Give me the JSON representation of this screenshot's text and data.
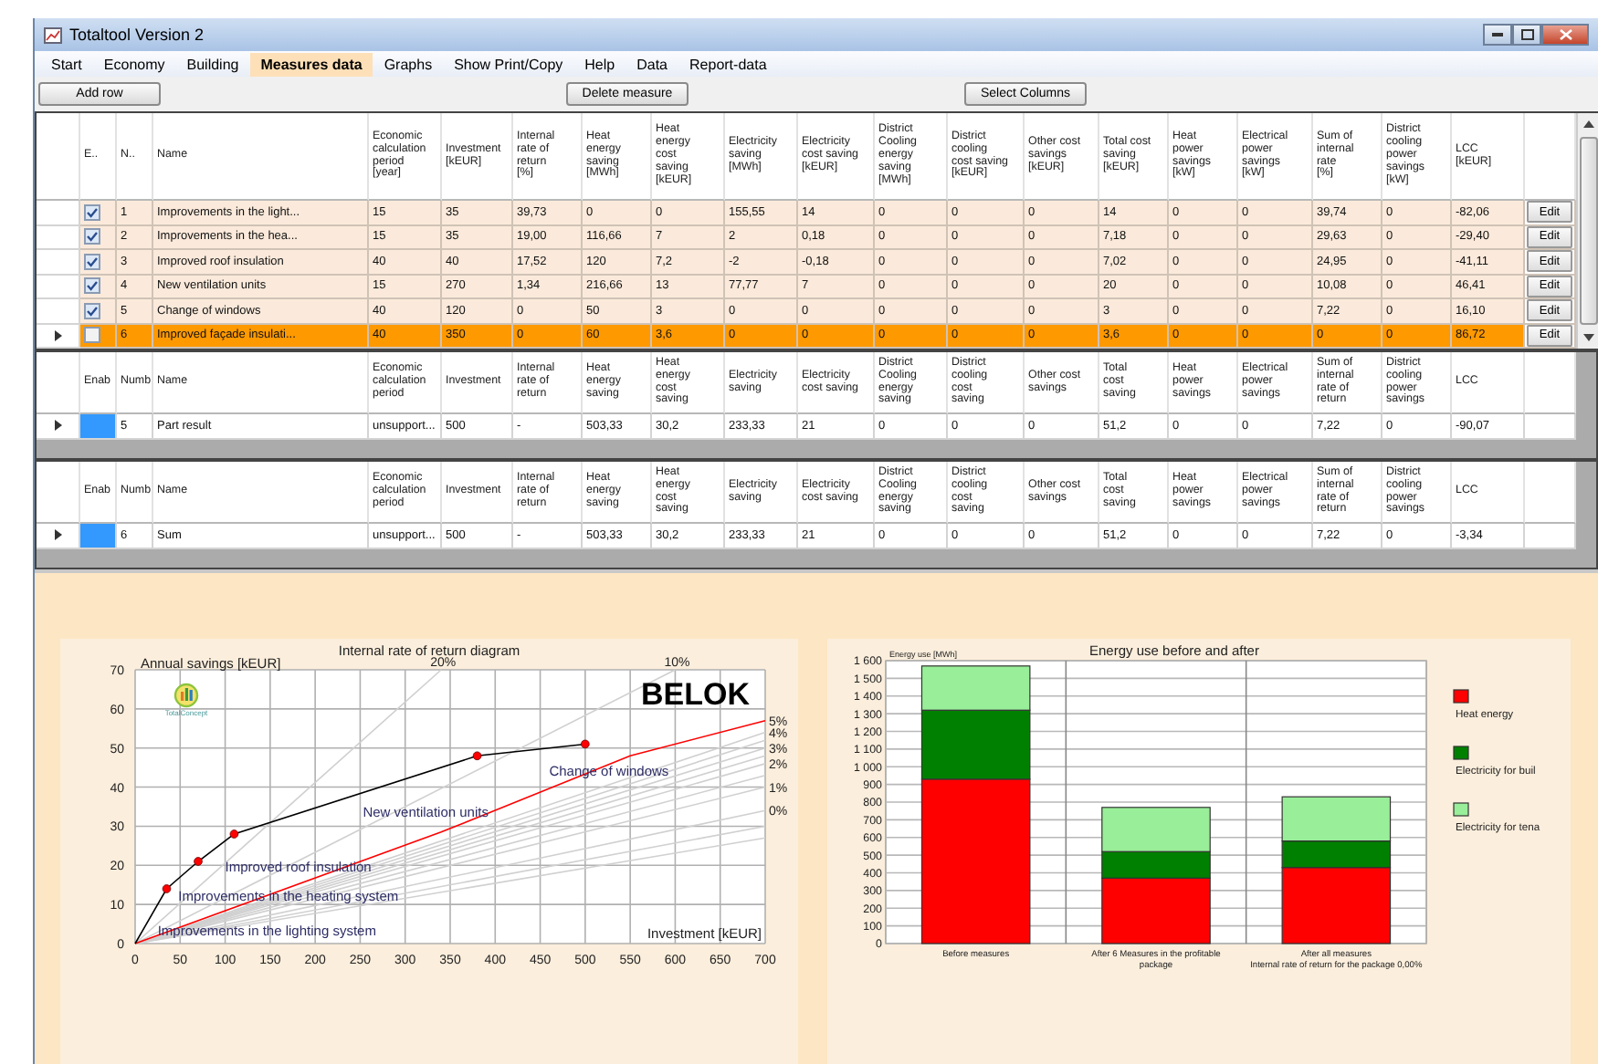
{
  "window": {
    "title": "Totaltool Version 2"
  },
  "menu": [
    {
      "label": "Start",
      "selected": false
    },
    {
      "label": "Economy",
      "selected": false
    },
    {
      "label": "Building",
      "selected": false
    },
    {
      "label": "Measures data",
      "selected": true
    },
    {
      "label": "Graphs",
      "selected": false
    },
    {
      "label": "Show Print/Copy",
      "selected": false
    },
    {
      "label": "Help",
      "selected": false
    },
    {
      "label": "Data",
      "selected": false
    },
    {
      "label": "Report-data",
      "selected": false
    }
  ],
  "toolbar": [
    "Add row",
    "Delete measure",
    "Select Columns"
  ],
  "measures": {
    "columns": [
      "E..",
      "N..",
      "Name",
      "Economic\ncalculation\nperiod\n[year]",
      "Investment\n[kEUR]",
      "Internal\nrate of\nreturn\n[%]",
      "Heat\nenergy\nsaving\n[MWh]",
      "Heat\nenergy\ncost\nsaving\n[kEUR]",
      "Electricity\nsaving\n[MWh]",
      "Electricity\ncost saving\n[kEUR]",
      "District\nCooling\nenergy\nsaving\n[MWh]",
      "District\ncooling\ncost saving\n[kEUR]",
      "Other cost\nsavings\n[kEUR]",
      "Total cost\nsaving\n[kEUR]",
      "Heat\npower\nsavings\n[kW]",
      "Electrical\npower\nsavings\n[kW]",
      "Sum of\ninternal\nrate\n[%]",
      "District\ncooling\npower\nsavings\n[kW]",
      "LCC\n[kEUR]"
    ],
    "rows": [
      {
        "enabled": true,
        "selected": false,
        "cells": [
          "",
          "1",
          "Improvements in the light...",
          "15",
          "35",
          "39,73",
          "0",
          "0",
          "155,55",
          "14",
          "0",
          "0",
          "0",
          "14",
          "0",
          "0",
          "39,74",
          "0",
          "-82,06"
        ],
        "button": "Edit"
      },
      {
        "enabled": true,
        "selected": false,
        "cells": [
          "",
          "2",
          "Improvements in the hea...",
          "15",
          "35",
          "19,00",
          "116,66",
          "7",
          "2",
          "0,18",
          "0",
          "0",
          "0",
          "7,18",
          "0",
          "0",
          "29,63",
          "0",
          "-29,40"
        ],
        "button": "Edit"
      },
      {
        "enabled": true,
        "selected": false,
        "cells": [
          "",
          "3",
          "Improved roof insulation",
          "40",
          "40",
          "17,52",
          "120",
          "7,2",
          "-2",
          "-0,18",
          "0",
          "0",
          "0",
          "7,02",
          "0",
          "0",
          "24,95",
          "0",
          "-41,11"
        ],
        "button": "Edit"
      },
      {
        "enabled": true,
        "selected": false,
        "cells": [
          "",
          "4",
          "New ventilation units",
          "15",
          "270",
          "1,34",
          "216,66",
          "13",
          "77,77",
          "7",
          "0",
          "0",
          "0",
          "20",
          "0",
          "0",
          "10,08",
          "0",
          "46,41"
        ],
        "button": "Edit"
      },
      {
        "enabled": true,
        "selected": false,
        "cells": [
          "",
          "5",
          "Change of windows",
          "40",
          "120",
          "0",
          "50",
          "3",
          "0",
          "0",
          "0",
          "0",
          "0",
          "3",
          "0",
          "0",
          "7,22",
          "0",
          "16,10"
        ],
        "button": "Edit"
      },
      {
        "enabled": false,
        "selected": true,
        "cells": [
          "",
          "6",
          "Improved façade insulati...",
          "40",
          "350",
          "0",
          "60",
          "3,6",
          "0",
          "0",
          "0",
          "0",
          "0",
          "3,6",
          "0",
          "0",
          "0",
          "0",
          "86,72"
        ],
        "button": "Edit"
      }
    ]
  },
  "part_result": {
    "columns": [
      "Enab",
      "Numb",
      "Name",
      "Economic\ncalculation\nperiod",
      "Investment",
      "Internal\nrate of\nreturn",
      "Heat\nenergy\nsaving",
      "Heat\nenergy\ncost\nsaving",
      "Electricity\nsaving",
      "Electricity\ncost saving",
      "District\nCooling\nenergy\nsaving",
      "District\ncooling\ncost\nsaving",
      "Other cost\nsavings",
      "Total\ncost\nsaving",
      "Heat\npower\nsavings",
      "Electrical\npower\nsavings",
      "Sum of\ninternal\nrate of\nreturn",
      "District\ncooling\npower\nsavings",
      "LCC"
    ],
    "rows": [
      {
        "selected": true,
        "cells": [
          "",
          "5",
          "Part result",
          "unsupport...",
          "500",
          "-",
          "503,33",
          "30,2",
          "233,33",
          "21",
          "0",
          "0",
          "0",
          "51,2",
          "0",
          "0",
          "7,22",
          "0",
          "-90,07"
        ]
      }
    ]
  },
  "sum": {
    "columns": [
      "Enab",
      "Numb",
      "Name",
      "Economic\ncalculation\nperiod",
      "Investment",
      "Internal\nrate of\nreturn",
      "Heat\nenergy\nsaving",
      "Heat\nenergy\ncost\nsaving",
      "Electricity\nsaving",
      "Electricity\ncost saving",
      "District\nCooling\nenergy\nsaving",
      "District\ncooling\ncost\nsaving",
      "Other cost\nsavings",
      "Total\ncost\nsaving",
      "Heat\npower\nsavings",
      "Electrical\npower\nsavings",
      "Sum of\ninternal\nrate of\nreturn",
      "District\ncooling\npower\nsavings",
      "LCC"
    ],
    "rows": [
      {
        "selected": true,
        "cells": [
          "",
          "6",
          "Sum",
          "unsupport...",
          "500",
          "-",
          "503,33",
          "30,2",
          "233,33",
          "21",
          "0",
          "0",
          "0",
          "51,2",
          "0",
          "0",
          "7,22",
          "0",
          "-3,34"
        ]
      }
    ]
  },
  "irr_chart": {
    "logos": [
      {
        "kind": "totalconcept",
        "text": "TotalConcept"
      },
      {
        "kind": "belok",
        "text": "BELOK"
      }
    ],
    "chart_data": {
      "type": "line",
      "title": "Internal rate of return diagram",
      "xlabel": "Investment [kEUR]",
      "ylabel": "Annual savings [kEUR]",
      "xlim": [
        0,
        700
      ],
      "ylim": [
        0,
        70
      ],
      "grid": true,
      "xticks": [
        0,
        50,
        100,
        150,
        200,
        250,
        300,
        350,
        400,
        450,
        500,
        550,
        600,
        650,
        700
      ],
      "yticks": [
        0,
        10,
        20,
        30,
        40,
        50,
        60,
        70
      ],
      "series": [
        {
          "color": "#000000",
          "marker": "circle",
          "x": [
            0,
            35,
            70,
            110,
            380,
            500
          ],
          "values": [
            0,
            14,
            21,
            28,
            48,
            51
          ]
        },
        {
          "name": "5%",
          "color": "#ff0000",
          "x": [
            0,
            340,
            550,
            700
          ],
          "values": [
            0,
            28.5,
            48,
            57
          ]
        },
        {
          "name": "20%",
          "color": "#d0d0d0",
          "x": [
            0,
            340
          ],
          "values": [
            0,
            70
          ]
        },
        {
          "name": "10%",
          "color": "#d0d0d0",
          "x": [
            0,
            600
          ],
          "values": [
            0,
            70
          ]
        },
        {
          "name": "4%",
          "color": "#d0d0d0",
          "x": [
            0,
            700
          ],
          "values": [
            0,
            54
          ]
        },
        {
          "color": "#d0d0d0",
          "x": [
            0,
            700
          ],
          "values": [
            0,
            52
          ]
        },
        {
          "name": "3%",
          "color": "#d0d0d0",
          "x": [
            0,
            700
          ],
          "values": [
            0,
            50
          ]
        },
        {
          "color": "#d0d0d0",
          "x": [
            0,
            700
          ],
          "values": [
            0,
            48
          ]
        },
        {
          "name": "2%",
          "color": "#d0d0d0",
          "x": [
            0,
            700
          ],
          "values": [
            0,
            46
          ]
        },
        {
          "color": "#d0d0d0",
          "x": [
            0,
            700
          ],
          "values": [
            0,
            43
          ]
        },
        {
          "name": "1%",
          "color": "#d0d0d0",
          "x": [
            0,
            700
          ],
          "values": [
            0,
            40
          ]
        },
        {
          "name": "0%",
          "color": "#d0d0d0",
          "x": [
            0,
            700
          ],
          "values": [
            0,
            34
          ]
        },
        {
          "color": "#d0d0d0",
          "x": [
            0,
            700
          ],
          "values": [
            0,
            30
          ]
        },
        {
          "color": "#d0d0d0",
          "x": [
            0,
            700
          ],
          "values": [
            0,
            27
          ]
        }
      ],
      "annotations": [
        "Improvements in the lighting system",
        "Improvements in the heating system",
        "Improved roof insulation",
        "New ventilation units",
        "Change of windows"
      ]
    }
  },
  "energy_chart": {
    "chart_data": {
      "type": "bar",
      "stacked": true,
      "title": "Energy use before and after",
      "ylabel": "Energy use [MWh]",
      "ylim": [
        0,
        1600
      ],
      "grid": true,
      "legend": "right",
      "categories": [
        "Before measures",
        "After 6 Measures in the profitable\npackage",
        "After all measures\nInternal rate of return for the package 0,00%"
      ],
      "yticks": [
        0,
        100,
        200,
        300,
        400,
        500,
        600,
        700,
        800,
        900,
        {
          "value": 1000,
          "label": "1 000"
        },
        {
          "value": 1100,
          "label": "1 100"
        },
        {
          "value": 1200,
          "label": "1 200"
        },
        {
          "value": 1300,
          "label": "1 300"
        },
        {
          "value": 1400,
          "label": "1 400"
        },
        {
          "value": 1500,
          "label": "1 500"
        },
        {
          "value": 1600,
          "label": "1 600"
        }
      ],
      "series": [
        {
          "name": "Heat energy",
          "color": "#ff0000",
          "values": [
            930,
            370,
            430
          ]
        },
        {
          "name": "Electricity for buil",
          "color": "#008000",
          "values": [
            390,
            150,
            150
          ]
        },
        {
          "name": "Electricity for tena",
          "color": "#99ee99",
          "values": [
            250,
            250,
            250
          ]
        }
      ]
    }
  }
}
